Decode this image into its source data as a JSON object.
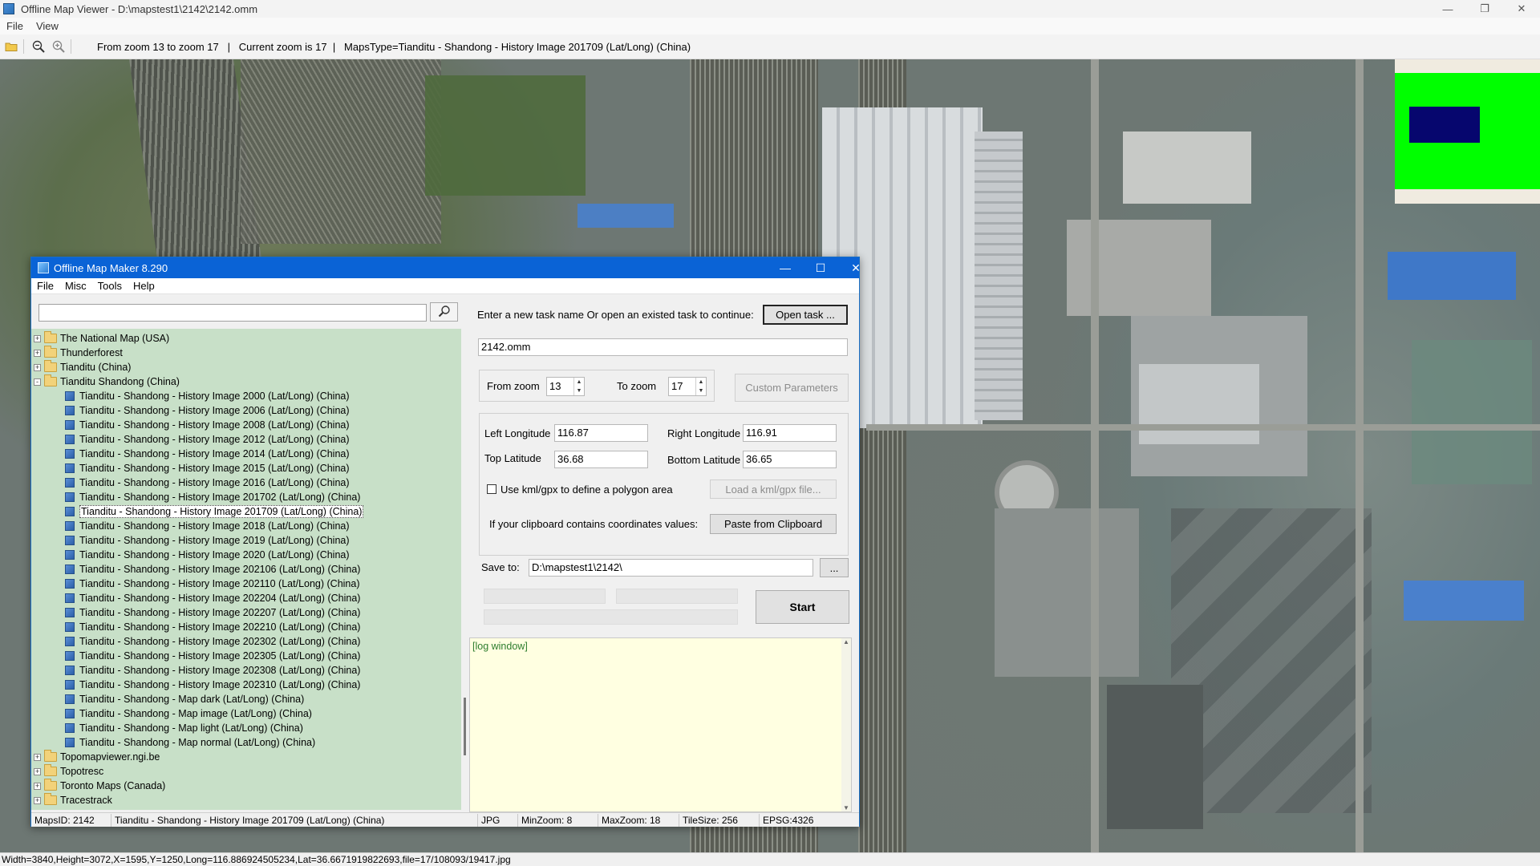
{
  "viewer": {
    "title": "Offline Map Viewer - D:\\mapstest1\\2142\\2142.omm",
    "window_controls": {
      "minimize": "—",
      "restore": "❐",
      "close": "✕"
    },
    "menu": [
      "File",
      "View"
    ],
    "toolbar_info": "From zoom 13 to zoom 17   |   Current zoom is 17  |   MapsType=Tianditu - Shandong - History Image 201709 (Lat/Long) (China)",
    "status": "Width=3840,Height=3072,X=1595,Y=1250,Long=116.886924505234,Lat=36.6671919822693,file=17/108093/19417.jpg"
  },
  "dialog": {
    "title": "Offline Map Maker 8.290",
    "window_controls": {
      "minimize": "—",
      "maximize": "☐",
      "close": "✕"
    },
    "menu": [
      "File",
      "Misc",
      "Tools",
      "Help"
    ],
    "search": {
      "value": "",
      "placeholder": ""
    },
    "tree": [
      {
        "label": "The National Map (USA)",
        "type": "folder",
        "expander": "+"
      },
      {
        "label": "Thunderforest",
        "type": "folder",
        "expander": "+"
      },
      {
        "label": "Tianditu (China)",
        "type": "folder",
        "expander": "+"
      },
      {
        "label": "Tianditu Shandong (China)",
        "type": "folder-open",
        "expander": "-"
      },
      {
        "label": "Tianditu - Shandong - History Image 2000 (Lat/Long) (China)",
        "type": "map"
      },
      {
        "label": "Tianditu - Shandong - History Image 2006 (Lat/Long) (China)",
        "type": "map"
      },
      {
        "label": "Tianditu - Shandong - History Image 2008 (Lat/Long) (China)",
        "type": "map"
      },
      {
        "label": "Tianditu - Shandong - History Image 2012 (Lat/Long) (China)",
        "type": "map"
      },
      {
        "label": "Tianditu - Shandong - History Image 2014 (Lat/Long) (China)",
        "type": "map"
      },
      {
        "label": "Tianditu - Shandong - History Image 2015 (Lat/Long) (China)",
        "type": "map"
      },
      {
        "label": "Tianditu - Shandong - History Image 2016 (Lat/Long) (China)",
        "type": "map"
      },
      {
        "label": "Tianditu - Shandong - History Image 201702 (Lat/Long) (China)",
        "type": "map"
      },
      {
        "label": "Tianditu - Shandong - History Image 201709 (Lat/Long) (China)",
        "type": "map",
        "selected": true
      },
      {
        "label": "Tianditu - Shandong - History Image 2018 (Lat/Long) (China)",
        "type": "map"
      },
      {
        "label": "Tianditu - Shandong - History Image 2019 (Lat/Long) (China)",
        "type": "map"
      },
      {
        "label": "Tianditu - Shandong - History Image 2020 (Lat/Long) (China)",
        "type": "map"
      },
      {
        "label": "Tianditu - Shandong - History Image 202106 (Lat/Long) (China)",
        "type": "map"
      },
      {
        "label": "Tianditu - Shandong - History Image 202110 (Lat/Long) (China)",
        "type": "map"
      },
      {
        "label": "Tianditu - Shandong - History Image 202204 (Lat/Long) (China)",
        "type": "map"
      },
      {
        "label": "Tianditu - Shandong - History Image 202207 (Lat/Long) (China)",
        "type": "map"
      },
      {
        "label": "Tianditu - Shandong - History Image 202210 (Lat/Long) (China)",
        "type": "map"
      },
      {
        "label": "Tianditu - Shandong - History Image 202302 (Lat/Long) (China)",
        "type": "map"
      },
      {
        "label": "Tianditu - Shandong - History Image 202305 (Lat/Long) (China)",
        "type": "map"
      },
      {
        "label": "Tianditu - Shandong - History Image 202308 (Lat/Long) (China)",
        "type": "map"
      },
      {
        "label": "Tianditu - Shandong - History Image 202310 (Lat/Long) (China)",
        "type": "map"
      },
      {
        "label": "Tianditu - Shandong - Map dark (Lat/Long) (China)",
        "type": "map"
      },
      {
        "label": "Tianditu - Shandong - Map image (Lat/Long) (China)",
        "type": "map"
      },
      {
        "label": "Tianditu - Shandong - Map light (Lat/Long) (China)",
        "type": "map"
      },
      {
        "label": "Tianditu - Shandong - Map normal (Lat/Long) (China)",
        "type": "map"
      },
      {
        "label": "Topomapviewer.ngi.be",
        "type": "folder",
        "expander": "+"
      },
      {
        "label": "Topotresc",
        "type": "folder",
        "expander": "+"
      },
      {
        "label": "Toronto Maps (Canada)",
        "type": "folder",
        "expander": "+"
      },
      {
        "label": "Tracestrack",
        "type": "folder",
        "expander": "+"
      }
    ],
    "task": {
      "prompt": "Enter a new task name Or open an existed task to continue:",
      "open_button": "Open task ...",
      "name_value": "2142.omm"
    },
    "zoom": {
      "from_label": "From zoom",
      "from_value": "13",
      "to_label": "To zoom",
      "to_value": "17",
      "custom_button": "Custom Parameters"
    },
    "coords": {
      "left_lon_label": "Left Longitude",
      "left_lon": "116.87",
      "right_lon_label": "Right Longitude",
      "right_lon": "116.91",
      "top_lat_label": "Top Latitude",
      "top_lat": "36.68",
      "bottom_lat_label": "Bottom Latitude",
      "bottom_lat": "36.65"
    },
    "kml": {
      "checkbox_label": "Use kml/gpx to define a polygon area",
      "checked": false,
      "load_button": "Load a kml/gpx file..."
    },
    "clipboard": {
      "label": "If your clipboard contains coordinates values:",
      "button": "Paste from Clipboard"
    },
    "save": {
      "label": "Save to:",
      "value": "D:\\mapstest1\\2142\\",
      "browse_button": "..."
    },
    "start_button": "Start",
    "log_text": "[log window]",
    "status": {
      "maps_id": "MapsID: 2142",
      "map_name": "Tianditu - Shandong - History Image 201709 (Lat/Long) (China)",
      "format": "JPG",
      "min_zoom": "MinZoom: 8",
      "max_zoom": "MaxZoom: 18",
      "tile_size": "TileSize: 256",
      "epsg": "EPSG:4326"
    }
  },
  "colors": {
    "dialog_title": "#0a63d6",
    "tree_bg": "#c8e0c8",
    "log_bg": "#ffffe1",
    "minimap_green": "#00ff00",
    "minimap_frame": "#06066e"
  }
}
